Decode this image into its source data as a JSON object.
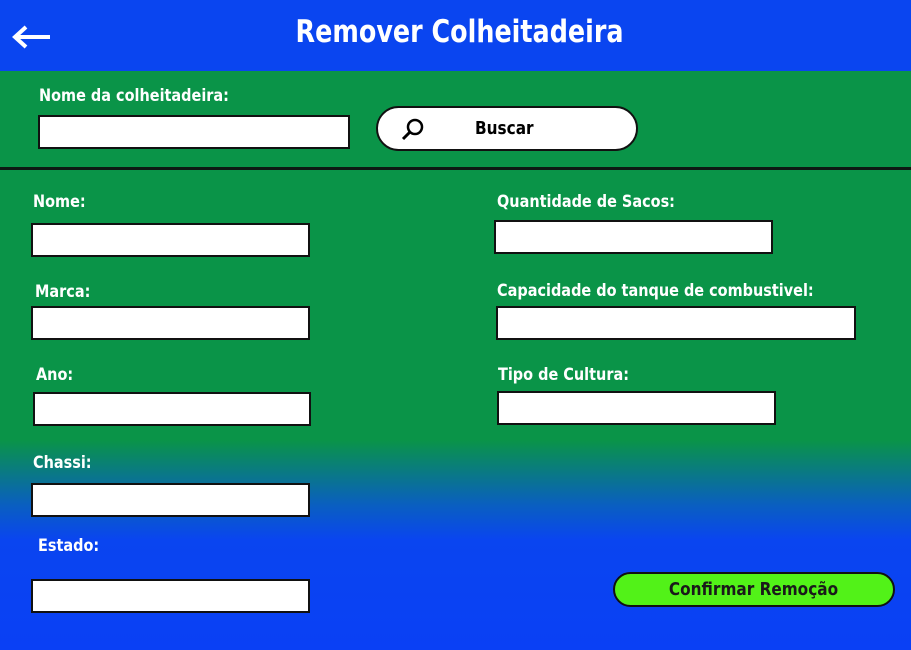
{
  "header": {
    "title": "Remover Colheitadeira",
    "back_icon": "arrow-left-icon"
  },
  "search": {
    "label": "Nome da colheitadeira:",
    "input_value": "",
    "button_label": "Buscar",
    "button_icon": "search-icon"
  },
  "form": {
    "nome_label": "Nome:",
    "marca_label": "Marca:",
    "ano_label": "Ano:",
    "chassi_label": "Chassi:",
    "estado_label": "Estado:",
    "sacos_label": "Quantidade de Sacos:",
    "tanque_label": "Capacidade do tanque de combustivel:",
    "cultura_label": "Tipo de Cultura:",
    "nome_value": "",
    "marca_value": "",
    "ano_value": "",
    "chassi_value": "",
    "estado_value": "",
    "sacos_value": "",
    "tanque_value": "",
    "cultura_value": ""
  },
  "actions": {
    "confirm_label": "Confirmar Remoção"
  },
  "colors": {
    "header_blue": "#0a45f0",
    "green": "#0a9448",
    "confirm_green": "#52f218"
  }
}
